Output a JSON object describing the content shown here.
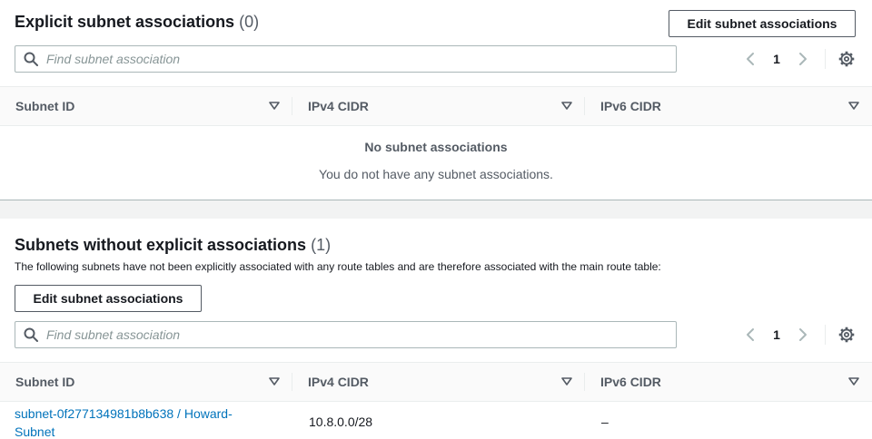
{
  "explicit": {
    "title": "Explicit subnet associations",
    "count": "(0)",
    "edit_button": "Edit subnet associations",
    "search_placeholder": "Find subnet association",
    "page": "1",
    "columns": [
      "Subnet ID",
      "IPv4 CIDR",
      "IPv6 CIDR"
    ],
    "empty_title": "No subnet associations",
    "empty_text": "You do not have any subnet associations."
  },
  "implicit": {
    "title": "Subnets without explicit associations",
    "count": "(1)",
    "description": "The following subnets have not been explicitly associated with any route tables and are therefore associated with the main route table:",
    "edit_button": "Edit subnet associations",
    "search_placeholder": "Find subnet association",
    "page": "1",
    "columns": [
      "Subnet ID",
      "IPv4 CIDR",
      "IPv6 CIDR"
    ],
    "rows": [
      {
        "subnet_id_line1": "subnet-0f277134981b8b638 / Howard-",
        "subnet_id_line2": "Subnet",
        "ipv4": "10.8.0.0/28",
        "ipv6": "–"
      }
    ]
  },
  "colors": {
    "link": "#0073bb",
    "text": "#16191f",
    "muted": "#545b64",
    "border": "#aab7b8"
  },
  "icons": [
    "search-icon",
    "chevron-left-icon",
    "chevron-right-icon",
    "gear-icon",
    "sort-caret-icon"
  ]
}
